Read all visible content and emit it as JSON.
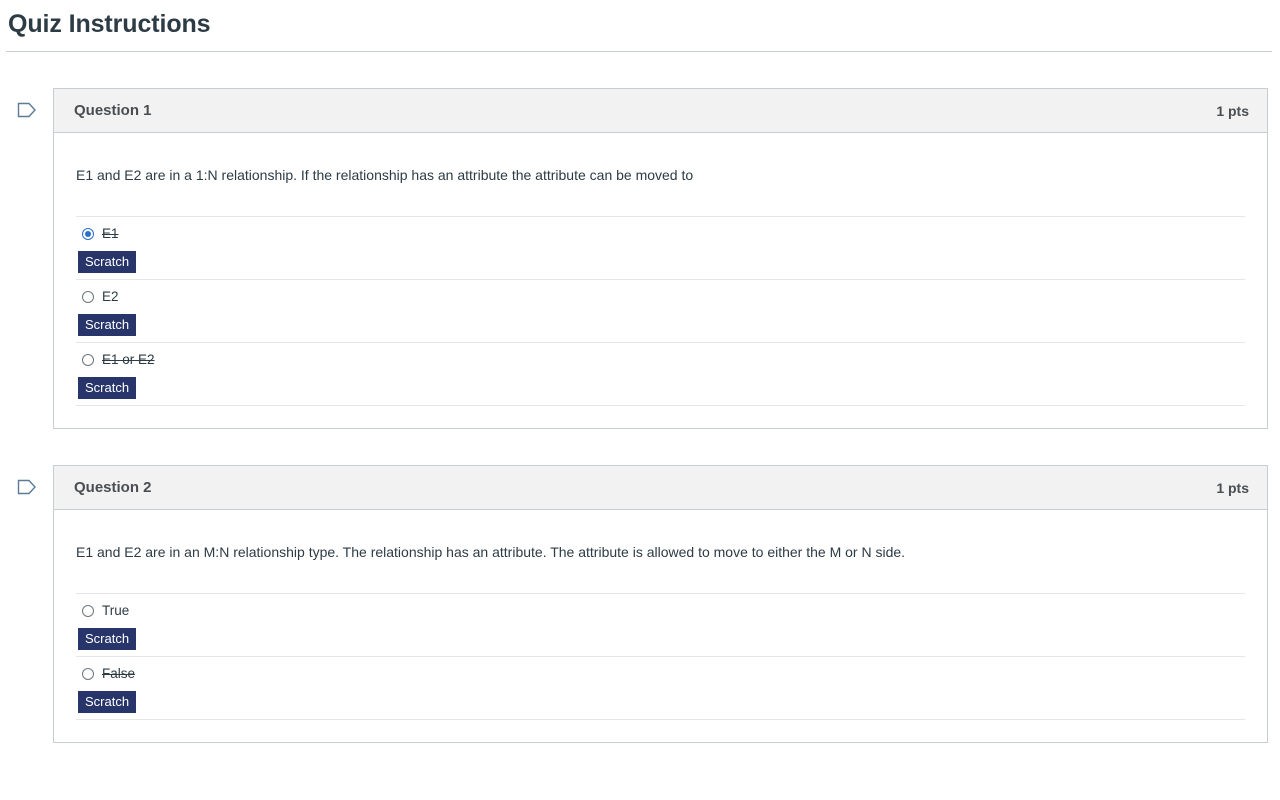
{
  "page": {
    "title": "Quiz Instructions"
  },
  "icons": {
    "flag": "flag-icon"
  },
  "questions": [
    {
      "name": "Question 1",
      "points": "1 pts",
      "text": "E1 and E2 are in a 1:N relationship.  If the relationship has an attribute the attribute can be moved to",
      "answers": [
        {
          "label": "E1",
          "selected": true,
          "struck": true,
          "scratch_label": "Scratch"
        },
        {
          "label": "E2",
          "selected": false,
          "struck": false,
          "scratch_label": "Scratch"
        },
        {
          "label": "E1 or E2",
          "selected": false,
          "struck": true,
          "scratch_label": "Scratch"
        }
      ]
    },
    {
      "name": "Question 2",
      "points": "1 pts",
      "text": "E1 and E2 are in an M:N relationship type.  The relationship has an attribute.  The attribute is allowed to move to either the M or N side.",
      "answers": [
        {
          "label": "True",
          "selected": false,
          "struck": false,
          "scratch_label": "Scratch"
        },
        {
          "label": "False",
          "selected": false,
          "struck": true,
          "scratch_label": "Scratch"
        }
      ]
    }
  ],
  "colors": {
    "accent_radio": "#2b6fc9",
    "scratch_button": "#27356b",
    "header_bg": "#f2f2f2",
    "border": "#c7cdd1",
    "flag_outline": "#5b7b96"
  }
}
